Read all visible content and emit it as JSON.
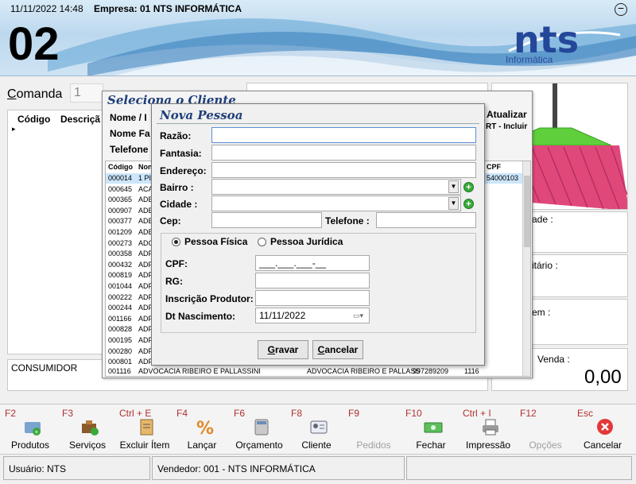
{
  "header": {
    "datetime": "11/11/2022 14:48",
    "empresa": "Empresa: 01 NTS INFORMÁTICA",
    "number": "02",
    "minimize": "−",
    "logo_text": "nts",
    "logo_sub": "Informática"
  },
  "comanda": {
    "label_u": "C",
    "label_rest": "omanda",
    "value": "1"
  },
  "left_panel": {
    "col_codigo": "Código",
    "col_descricao": "Descriçã",
    "arrow": "▸"
  },
  "consumidor": "CONSUMIDOR",
  "right_panel": {
    "label2": "ade :",
    "label3": "itário :",
    "label4": "em :",
    "venda_label": "Venda :",
    "venda_value": "0,00"
  },
  "seleciona": {
    "title": "Seleciona o Cliente",
    "label_nome": "Nome / I",
    "label_fantasia": "Nome Fa",
    "label_telefone": "Telefone",
    "atualizar": "Atualizar",
    "incluir": "RT - Incluir",
    "col_codigo": "Código",
    "col_nome": "Non",
    "col_cpf": "CPF",
    "selected_cpf": "54000103",
    "rows": [
      {
        "code": "000014",
        "name": "1 PI",
        "sel": true
      },
      {
        "code": "000645",
        "name": "ACA"
      },
      {
        "code": "000365",
        "name": "ADE"
      },
      {
        "code": "000907",
        "name": "ADE"
      },
      {
        "code": "000377",
        "name": "ADE"
      },
      {
        "code": "001209",
        "name": "ADE"
      },
      {
        "code": "000273",
        "name": "ADC"
      },
      {
        "code": "000358",
        "name": "ADF"
      },
      {
        "code": "000432",
        "name": "ADF"
      },
      {
        "code": "000819",
        "name": "ADF"
      },
      {
        "code": "001044",
        "name": "ADF"
      },
      {
        "code": "000222",
        "name": "ADF"
      },
      {
        "code": "000244",
        "name": "ADF"
      },
      {
        "code": "001166",
        "name": "ADF"
      },
      {
        "code": "000828",
        "name": "ADF"
      },
      {
        "code": "000195",
        "name": "ADF"
      },
      {
        "code": "000280",
        "name": "ADF"
      },
      {
        "code": "000801",
        "name": "ADF"
      }
    ],
    "last_row": {
      "code": "001116",
      "name": "ADVOCACIA RIBEIRO E PALLASSINI",
      "fantasia": "ADVOCACIA RIBEIRO E PALLASS",
      "phone": "997289209",
      "extra": "1116"
    }
  },
  "nova_pessoa": {
    "title": "Nova Pessoa",
    "razao": "Razão:",
    "fantasia": "Fantasia:",
    "endereco": "Endereço:",
    "bairro": "Bairro :",
    "cidade": "Cidade :",
    "cep": "Cep:",
    "telefone": "Telefone :",
    "pessoa_fisica": "Pessoa Física",
    "pessoa_juridica": "Pessoa Jurídica",
    "cpf": "CPF:",
    "cpf_value": "___.___.___-__",
    "rg": "RG:",
    "inscricao": "Inscrição Produtor:",
    "dt_nasc": "Dt Nascimento:",
    "dt_value": "11/11/2022",
    "gravar_u": "G",
    "gravar_rest": "ravar",
    "cancelar_u": "C",
    "cancelar_rest": "ancelar"
  },
  "toolbar": [
    {
      "key": "F2",
      "label": "Produtos",
      "icon": "products-icon",
      "disabled": false
    },
    {
      "key": "F3",
      "label": "Serviços",
      "icon": "services-icon",
      "disabled": false
    },
    {
      "key": "Ctrl + E",
      "label": "Excluir Ítem",
      "icon": "delete-item-icon",
      "disabled": false
    },
    {
      "key": "F4",
      "label": "Lançar",
      "icon": "percent-icon",
      "disabled": false
    },
    {
      "key": "F6",
      "label": "Orçamento",
      "icon": "calculator-icon",
      "disabled": false
    },
    {
      "key": "F8",
      "label": "Cliente",
      "icon": "client-card-icon",
      "disabled": false
    },
    {
      "key": "F9",
      "label": "Pedidos",
      "icon": "orders-icon",
      "disabled": true
    },
    {
      "key": "F10",
      "label": "Fechar",
      "icon": "cash-icon",
      "disabled": false
    },
    {
      "key": "Ctrl + I",
      "label": "Impressão",
      "icon": "printer-icon",
      "disabled": false
    },
    {
      "key": "F12",
      "label": "Opções",
      "icon": "options-icon",
      "disabled": true
    },
    {
      "key": "Esc",
      "label": "Cancelar",
      "icon": "cancel-icon",
      "disabled": false
    }
  ],
  "status": {
    "usuario": "Usuário: NTS",
    "vendedor": "Vendedor: 001 - NTS INFORMÁTICA"
  },
  "colors": {
    "accent": "#1f3f7a",
    "key_red": "#b03030",
    "selected_row": "#cce6fb",
    "broom_pink": "#e0487a",
    "broom_green": "#5fcf3c"
  }
}
